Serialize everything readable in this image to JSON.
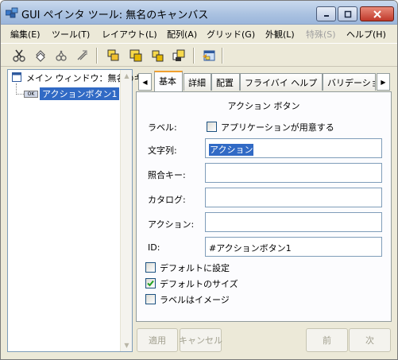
{
  "window": {
    "title": "GUI ペインタ ツール: 無名のキャンバス"
  },
  "menu": [
    {
      "label": "編集(E)",
      "disabled": false
    },
    {
      "label": "ツール(T)",
      "disabled": false
    },
    {
      "label": "レイアウト(L)",
      "disabled": false
    },
    {
      "label": "配列(A)",
      "disabled": false
    },
    {
      "label": "グリッド(G)",
      "disabled": false
    },
    {
      "label": "外観(L)",
      "disabled": false
    },
    {
      "label": "特殊(S)",
      "disabled": true
    },
    {
      "label": "ヘルプ(H)",
      "disabled": false
    }
  ],
  "tree": {
    "root_label": "メイン ウィンドウ：無名のキャンバス",
    "child_badge": "OK",
    "child_label": "アクションボタン1"
  },
  "tabs": [
    "基本",
    "詳細",
    "配置",
    "フライバイ ヘルプ",
    "バリデーション"
  ],
  "panel": {
    "title": "アクション ボタン",
    "label_label": "ラベル:",
    "app_provided_label": "アプリケーションが用意する",
    "string_label": "文字列:",
    "string_value": "アクション",
    "key_label": "照合キー:",
    "key_value": "",
    "catalog_label": "カタログ:",
    "catalog_value": "",
    "action_label": "アクション:",
    "action_value": "",
    "id_label": "ID:",
    "id_value": "#アクションボタン1",
    "default_label": "デフォルトに設定",
    "default_size_label": "デフォルトのサイズ",
    "label_image_label": "ラベルはイメージ",
    "app_provided_checked": false,
    "default_checked": false,
    "default_size_checked": true,
    "label_image_checked": false
  },
  "buttons": {
    "apply": "適用",
    "cancel": "キャンセル",
    "prev": "前",
    "next": "次"
  },
  "colors": {
    "selection": "#316ac5",
    "tab_highlight": "#f0a030"
  }
}
